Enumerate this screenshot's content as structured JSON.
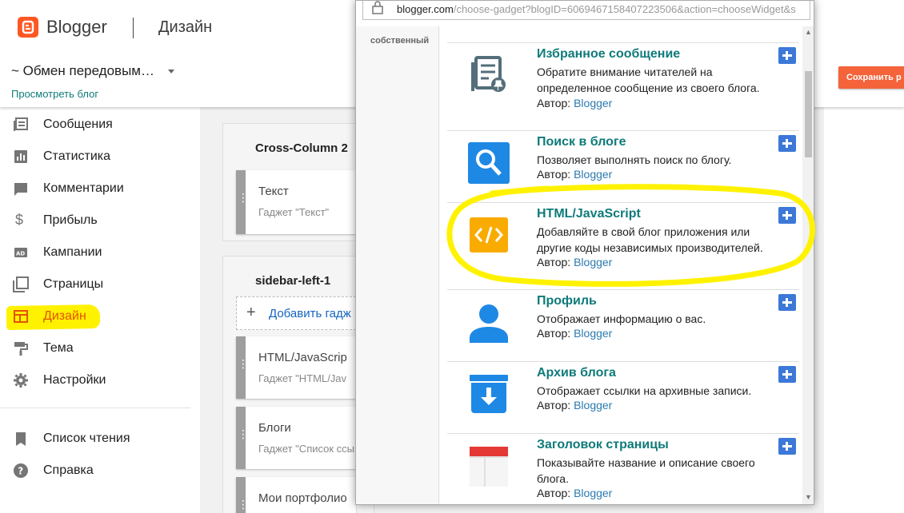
{
  "header": {
    "brand": "Blogger",
    "section": "Дизайн"
  },
  "subheader": {
    "blog_name": "~ Обмен передовым…",
    "view_blog": "Просмотреть блог",
    "save_button": "Сохранить р"
  },
  "sidebar": {
    "items": [
      {
        "label": "Сообщения",
        "icon": "posts-icon"
      },
      {
        "label": "Статистика",
        "icon": "stats-icon"
      },
      {
        "label": "Комментарии",
        "icon": "comments-icon"
      },
      {
        "label": "Прибыль",
        "icon": "dollar-icon"
      },
      {
        "label": "Кампании",
        "icon": "ad-icon"
      },
      {
        "label": "Страницы",
        "icon": "pages-icon"
      },
      {
        "label": "Дизайн",
        "icon": "layout-icon",
        "active": true
      },
      {
        "label": "Тема",
        "icon": "paint-roller-icon"
      },
      {
        "label": "Настройки",
        "icon": "gear-icon"
      }
    ],
    "secondary": [
      {
        "label": "Список чтения",
        "icon": "bookmark-icon"
      },
      {
        "label": "Справка",
        "icon": "help-icon"
      }
    ]
  },
  "layout": {
    "cross_column_title": "Cross-Column 2",
    "text_gadget": {
      "title": "Текст",
      "subtitle": "Гаджет \"Текст\""
    },
    "sidebar_title": "sidebar-left-1",
    "add_gadget": "Добавить гадж",
    "gadgets": [
      {
        "title": "HTML/JavaScrip",
        "subtitle": "Гаджет \"HTML/Jav"
      },
      {
        "title": "Блоги",
        "subtitle": "Гаджет \"Список ссы"
      },
      {
        "title": "Мои портфолио",
        "subtitle": ""
      }
    ]
  },
  "popup": {
    "url_host": "blogger.com",
    "url_path": "/choose-gadget?blogID=6069467158407223506&action=chooseWidget&s",
    "tab": "собственный",
    "author_prefix": "Автор:",
    "gadgets": [
      {
        "name": "Избранное сообщение",
        "desc": "Обратите внимание читателей на определенное сообщение из своего блога.",
        "author": "Blogger",
        "icon": "featured-post-icon"
      },
      {
        "name": "Поиск в блоге",
        "desc": "Позволяет выполнять поиск по блогу.",
        "author": "Blogger",
        "icon": "search-icon"
      },
      {
        "name": "HTML/JavaScript",
        "desc": "Добавляйте в свой блог приложения или другие коды независимых производителей.",
        "author": "Blogger",
        "icon": "code-icon"
      },
      {
        "name": "Профиль",
        "desc": "Отображает информацию о вас.",
        "author": "Blogger",
        "icon": "profile-icon"
      },
      {
        "name": "Архив блога",
        "desc": "Отображает ссылки на архивные записи.",
        "author": "Blogger",
        "icon": "archive-icon"
      },
      {
        "name": "Заголовок страницы",
        "desc": "Показывайте название и описание своего блога.",
        "author": "Blogger",
        "icon": "page-header-icon"
      }
    ]
  },
  "colors": {
    "accent": "#0f7a7a",
    "active_nav": "#e65100",
    "brand": "#ff5722",
    "highlight": "#fff200",
    "add_button": "#3c78d8"
  }
}
